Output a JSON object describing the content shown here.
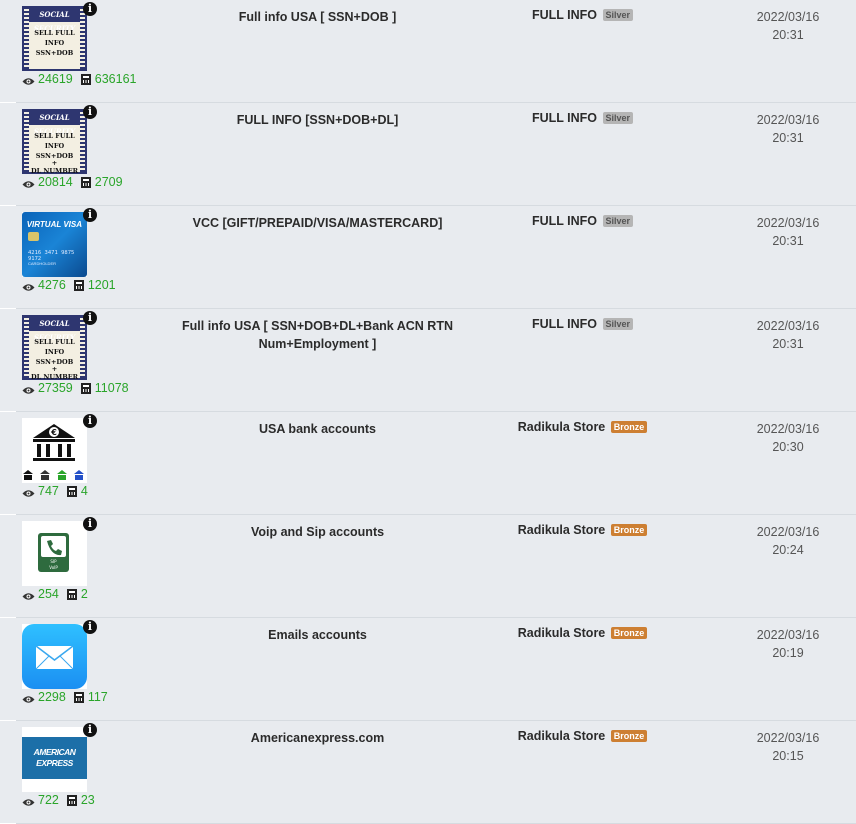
{
  "rows": [
    {
      "title": "Full info USA [ SSN+DOB ]",
      "seller": "FULL INFO",
      "badge": "Silver",
      "date": "2022/03/16",
      "time": "20:31",
      "views": "24619",
      "stock": "636161",
      "thumb": {
        "kind": "ssn",
        "head": "SOCIAL SECURITY",
        "line1": "SELL FULL INFO",
        "line2": "SSN+DOB",
        "line3": "",
        "line4": ""
      }
    },
    {
      "title": "FULL INFO [SSN+DOB+DL]",
      "seller": "FULL INFO",
      "badge": "Silver",
      "date": "2022/03/16",
      "time": "20:31",
      "views": "20814",
      "stock": "2709",
      "thumb": {
        "kind": "ssn",
        "head": "SOCIAL SECURITY",
        "line1": "SELL FULL INFO",
        "line2": "SSN+DOB",
        "line3": "+",
        "line4": "DL NUMBER"
      }
    },
    {
      "title": "VCC [GIFT/PREPAID/VISA/MASTERCARD]",
      "seller": "FULL INFO",
      "badge": "Silver",
      "date": "2022/03/16",
      "time": "20:31",
      "views": "4276",
      "stock": "1201",
      "thumb": {
        "kind": "vcc",
        "label": "VIRTUAL VISA",
        "number": "4216 3471 9875 9172",
        "name": "CARDHOLDER"
      }
    },
    {
      "title": "Full info USA [ SSN+DOB+DL+Bank ACN RTN Num+Employment ]",
      "seller": "FULL INFO",
      "badge": "Silver",
      "date": "2022/03/16",
      "time": "20:31",
      "views": "27359",
      "stock": "11078",
      "thumb": {
        "kind": "ssn",
        "head": "SOCIAL SECURITY",
        "line1": "SELL FULL INFO",
        "line2": "SSN+DOB",
        "line3": "+",
        "line4": "DL NUMBER"
      }
    },
    {
      "title": "USA bank accounts",
      "seller": "Radikula Store",
      "badge": "Bronze",
      "date": "2022/03/16",
      "time": "20:30",
      "views": "747",
      "stock": "4",
      "thumb": {
        "kind": "bank",
        "symbol": "€"
      }
    },
    {
      "title": "Voip and Sip accounts",
      "seller": "Radikula Store",
      "badge": "Bronze",
      "date": "2022/03/16",
      "time": "20:24",
      "views": "254",
      "stock": "2",
      "thumb": {
        "kind": "voip",
        "label1": "SIP",
        "label2": "VoIP"
      }
    },
    {
      "title": "Emails accounts",
      "seller": "Radikula Store",
      "badge": "Bronze",
      "date": "2022/03/16",
      "time": "20:19",
      "views": "2298",
      "stock": "117",
      "thumb": {
        "kind": "mail"
      }
    },
    {
      "title": "Americanexpress.com",
      "seller": "Radikula Store",
      "badge": "Bronze",
      "date": "2022/03/16",
      "time": "20:15",
      "views": "722",
      "stock": "23",
      "thumb": {
        "kind": "amex",
        "line1": "AMERICAN",
        "line2": "EXPRESS"
      }
    }
  ],
  "colors": {
    "accent_green": "#2aa52a",
    "badge_silver": "#b5b5b5",
    "badge_bronze": "#cd7f32",
    "background": "#e8ebef"
  }
}
